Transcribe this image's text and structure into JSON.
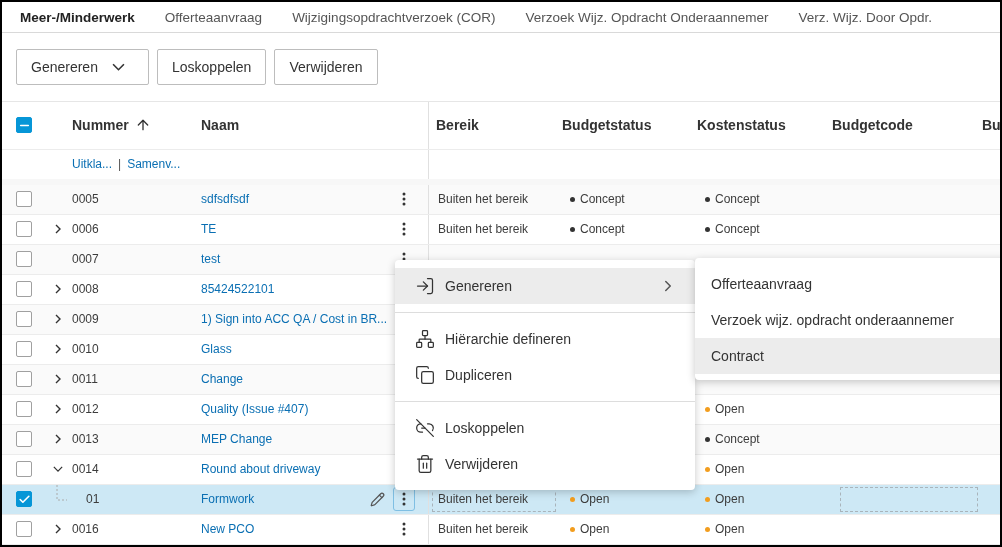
{
  "tabs": [
    {
      "label": "Meer-/Minderwerk",
      "selected": true
    },
    {
      "label": "Offerteaanvraag",
      "selected": false
    },
    {
      "label": "Wijzigingsopdrachtverzoek (COR)",
      "selected": false
    },
    {
      "label": "Verzoek Wijz. Opdracht Onderaannemer",
      "selected": false
    },
    {
      "label": "Verz. Wijz. Door Opdr.",
      "selected": false
    }
  ],
  "toolbar": [
    {
      "label": "Genereren",
      "kind": "dropdown"
    },
    {
      "label": "Loskoppelen",
      "kind": "plain"
    },
    {
      "label": "Verwijderen",
      "kind": "plain"
    }
  ],
  "table": {
    "select_all": {
      "checked": true,
      "indeterminate": true
    },
    "columns": [
      {
        "label": "Nummer",
        "sorted": true
      },
      {
        "label": "Naam",
        "sorted": false
      },
      {
        "label": "Bereik",
        "sorted": false
      },
      {
        "label": "Budgetstatus",
        "sorted": false
      },
      {
        "label": "Kostenstatus",
        "sorted": false
      },
      {
        "label": "Budgetcode",
        "sorted": false
      },
      {
        "label": "Bu"
      }
    ],
    "links": [
      {
        "label": "Uitkla..."
      },
      {
        "label": "Samenv..."
      }
    ],
    "link_separator": "|",
    "rows": [
      {
        "number": "0005",
        "name": "sdfsdfsdf",
        "checked": false,
        "selected": false,
        "scope": "Buiten het bereik",
        "budget_status": {
          "label": "Concept",
          "color": "#333333"
        },
        "cost_status": {
          "label": "Concept",
          "color": "#333333"
        }
      },
      {
        "number": "0006",
        "name": "TE",
        "expanded": false,
        "checked": false,
        "selected": false,
        "scope": "Buiten het bereik",
        "budget_status": {
          "label": "Concept",
          "color": "#333333"
        },
        "cost_status": {
          "label": "Concept",
          "color": "#333333"
        }
      },
      {
        "number": "0007",
        "name": "test",
        "checked": false,
        "selected": false
      },
      {
        "number": "0008",
        "name": "85424522101",
        "expanded": false,
        "checked": false,
        "selected": false
      },
      {
        "number": "0009",
        "name": "1) Sign into ACC QA / Cost in BR...",
        "expanded": false,
        "checked": false,
        "selected": false
      },
      {
        "number": "0010",
        "name": "Glass",
        "expanded": false,
        "checked": false,
        "selected": false
      },
      {
        "number": "0011",
        "name": "Change",
        "expanded": false,
        "checked": false,
        "selected": false
      },
      {
        "number": "0012",
        "name": "Quality (Issue #407)",
        "expanded": false,
        "checked": false,
        "selected": false,
        "cost_status": {
          "label": "Open",
          "color": "#f29d1e"
        }
      },
      {
        "number": "0013",
        "name": "MEP Change",
        "expanded": false,
        "checked": false,
        "selected": false,
        "cost_status": {
          "label": "Concept",
          "color": "#333333"
        }
      },
      {
        "number": "0014",
        "name": "Round about driveway",
        "expanded": true,
        "checked": false,
        "selected": false,
        "cost_status": {
          "label": "Open",
          "color": "#f29d1e"
        },
        "children": [
          {
            "number": "01",
            "name": "Formwork",
            "checked": true,
            "selected": true,
            "scope": "Buiten het bereik",
            "budget_status": {
              "label": "Open",
              "color": "#f29d1e"
            },
            "cost_status": {
              "label": "Open",
              "color": "#f29d1e"
            }
          }
        ]
      },
      {
        "number": "0016",
        "name": "New PCO",
        "expanded": false,
        "checked": false,
        "selected": false,
        "scope": "Buiten het bereik",
        "budget_status": {
          "label": "Open",
          "color": "#f29d1e"
        },
        "cost_status": {
          "label": "Open",
          "color": "#f29d1e"
        }
      }
    ]
  },
  "context_menu": {
    "groups": [
      [
        {
          "label": "Genereren",
          "has_submenu": true,
          "highlighted": true
        }
      ],
      [
        {
          "label": "Hiërarchie defineren",
          "has_submenu": false,
          "highlighted": false
        },
        {
          "label": "Dupliceren",
          "has_submenu": false,
          "highlighted": false
        }
      ],
      [
        {
          "label": "Loskoppelen",
          "has_submenu": false,
          "highlighted": false
        },
        {
          "label": "Verwijderen",
          "has_submenu": false,
          "highlighted": false
        }
      ]
    ],
    "submenu": [
      {
        "label": "Offerteaanvraag",
        "highlighted": false
      },
      {
        "label": "Verzoek wijz. opdracht onderaannemer",
        "highlighted": false
      },
      {
        "label": "Contract",
        "highlighted": true
      }
    ]
  }
}
